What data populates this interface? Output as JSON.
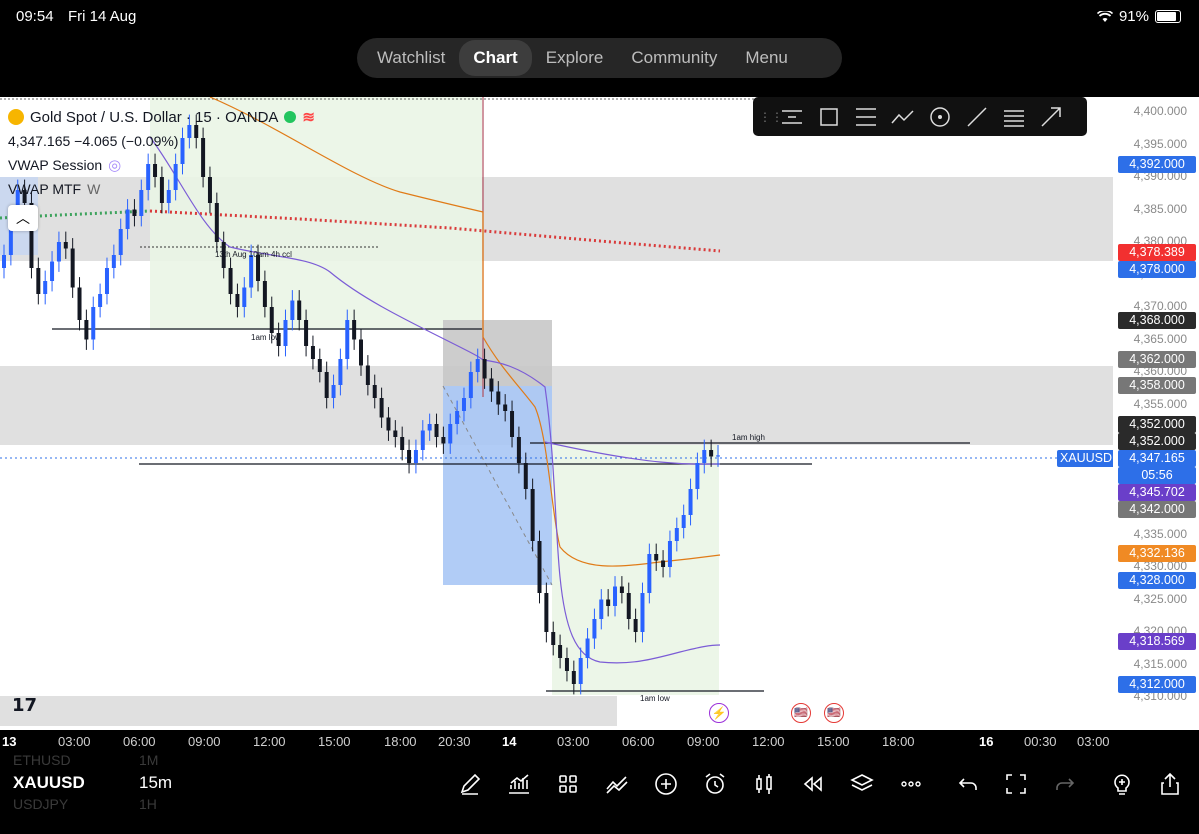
{
  "status_bar": {
    "time": "09:54",
    "date": "Fri 14 Aug",
    "battery": "91%"
  },
  "nav": {
    "tabs": [
      "Watchlist",
      "Chart",
      "Explore",
      "Community",
      "Menu"
    ],
    "active": "Chart"
  },
  "legend": {
    "symbol_title": "Gold Spot / U.S. Dollar · 15 · OANDA",
    "price_line": "4,347.165  −4.065 (−0.09%)",
    "indicator1": "VWAP Session",
    "indicator2_name": "VWAP MTF",
    "indicator2_param": "W"
  },
  "chart_data": {
    "type": "candlestick",
    "symbol": "XAUUSD",
    "interval": "15",
    "ylim": [
      4308,
      4402
    ],
    "price_ticks": [
      "4,400.000",
      "4,395.000",
      "4,390.000",
      "4,385.000",
      "4,380.000",
      "4,375.000",
      "4,370.000",
      "4,365.000",
      "4,360.000",
      "4,355.000",
      "4,350.000",
      "4,345.000",
      "4,340.000",
      "4,335.000",
      "4,330.000",
      "4,325.000",
      "4,320.000",
      "4,315.000",
      "4,310.000"
    ],
    "price_labels": [
      {
        "text": "4,392.000",
        "color": "#2d6fe8"
      },
      {
        "text": "4,378.389",
        "color": "#f23030"
      },
      {
        "text": "4,378.000",
        "color": "#2d6fe8"
      },
      {
        "text": "4,368.000",
        "color": "#2a2a2a"
      },
      {
        "text": "4,362.000",
        "color": "#777777"
      },
      {
        "text": "4,358.000",
        "color": "#777777"
      },
      {
        "text": "4,352.000",
        "color": "#2a2a2a"
      },
      {
        "text": "4,352.000",
        "color": "#2a2a2a"
      },
      {
        "text": "4,347.165",
        "color": "#2d6fe8"
      },
      {
        "text": "05:56",
        "color": "#2d6fe8"
      },
      {
        "text": "4,345.702",
        "color": "#6a3fc9"
      },
      {
        "text": "4,342.000",
        "color": "#777777"
      },
      {
        "text": "4,332.136",
        "color": "#f08a24"
      },
      {
        "text": "4,328.000",
        "color": "#2d6fe8"
      },
      {
        "text": "4,318.569",
        "color": "#6a3fc9"
      },
      {
        "text": "4,312.000",
        "color": "#2d6fe8"
      }
    ],
    "time_labels": [
      "13",
      "03:00",
      "06:00",
      "09:00",
      "12:00",
      "15:00",
      "18:00",
      "20:30",
      "14",
      "03:00",
      "06:00",
      "09:00",
      "12:00",
      "15:00",
      "18:00",
      "16",
      "00:30",
      "03:00"
    ],
    "current_tag": "XAUUSD",
    "annotations": [
      "13th Aug 10am 4h ccl",
      "1am low",
      "1am high",
      "1am low"
    ],
    "candles_close": [
      4378,
      4384,
      4388,
      4386,
      4376,
      4372,
      4374,
      4377,
      4380,
      4379,
      4373,
      4368,
      4365,
      4370,
      4372,
      4376,
      4378,
      4382,
      4385,
      4384,
      4388,
      4392,
      4390,
      4386,
      4388,
      4392,
      4396,
      4398,
      4396,
      4390,
      4386,
      4380,
      4376,
      4372,
      4370,
      4373,
      4378,
      4374,
      4370,
      4366,
      4364,
      4368,
      4371,
      4368,
      4364,
      4362,
      4360,
      4356,
      4358,
      4362,
      4368,
      4365,
      4361,
      4358,
      4356,
      4353,
      4351,
      4350,
      4348,
      4346,
      4348,
      4351,
      4352,
      4350,
      4349,
      4352,
      4354,
      4356,
      4360,
      4362,
      4359,
      4357,
      4355,
      4354,
      4350,
      4346,
      4342,
      4334,
      4326,
      4320,
      4318,
      4316,
      4314,
      4312,
      4316,
      4319,
      4322,
      4325,
      4324,
      4327,
      4326,
      4322,
      4320,
      4326,
      4332,
      4331,
      4330,
      4334,
      4336,
      4338,
      4342,
      4346,
      4348,
      4347,
      4347.165
    ]
  },
  "bottom": {
    "symbol": "XAUUSD",
    "interval": "15m",
    "ghost": [
      "ETHUSD",
      "1M",
      "USDJPY",
      "1H"
    ]
  },
  "colors": {
    "bull": "#2962ff",
    "bear": "#131722",
    "vwap": "#7b5cd6",
    "vwap2": "#e07b17",
    "mtf": "#d93b3b",
    "green": "#3da35d",
    "zone": "#d6d6d6",
    "long": "#a9c6f5",
    "longtarget": "#eaf5e6"
  }
}
